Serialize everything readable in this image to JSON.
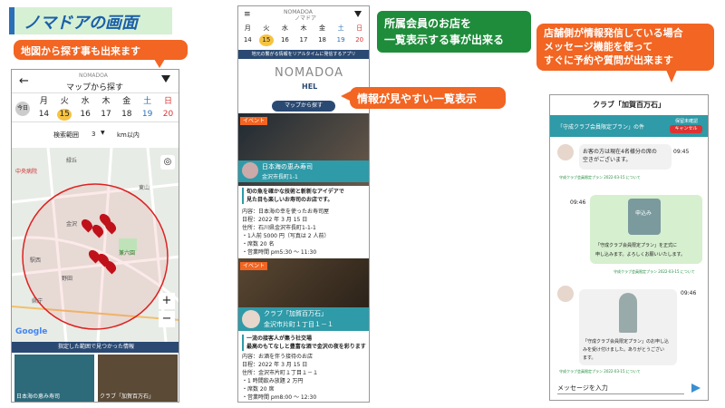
{
  "slide": {
    "title": "ノマドアの画面"
  },
  "callouts": {
    "map": "地図から探す事も出来ます",
    "list_title_1": "所属会員のお店を",
    "list_title_2": "一覧表示する事が出来る",
    "info": "情報が見やすい一覧表示",
    "msg_1": "店舗側が情報発信している場合",
    "msg_2": "メッセージ機能を使って",
    "msg_3": "すぐに予約や質問が出来ます"
  },
  "phone1": {
    "logo": "NOMADOA",
    "header": "マップから探す",
    "range_label": "検索範囲",
    "range_value": "3",
    "range_unit": "km以内",
    "weekday_label": "今日",
    "days": [
      "月",
      "火",
      "水",
      "木",
      "金",
      "土",
      "日"
    ],
    "dates": [
      "14",
      "15",
      "16",
      "17",
      "18",
      "19",
      "20"
    ],
    "result_bar": "指定した範囲で見つかった情報",
    "google": "Google",
    "plus": "+",
    "minus": "−",
    "map_labels": [
      "中央病院",
      "緑丘",
      "兼六園",
      "金沢",
      "駅西",
      "野田",
      "県庁",
      "東山"
    ],
    "thumb1": "日本海の恵み寿司",
    "thumb2": "クラブ「加賀百万石」"
  },
  "phone2": {
    "logo": "NOMADOA",
    "header_sub": "ノマドア",
    "days": [
      "月",
      "火",
      "水",
      "木",
      "金",
      "土",
      "日"
    ],
    "dates": [
      "14",
      "15",
      "16",
      "17",
      "18",
      "19",
      "20"
    ],
    "banner_text": "地元の繋がる情報をリアルタイムに発信するアプリ",
    "hero_logo": "NOMADOA",
    "hero_sub": "HEL",
    "map_button": "マップから探す",
    "event_tag": "イベント",
    "card1": {
      "name_1": "日本海の恵み寿司",
      "name_2": "金沢市長町1-1",
      "desc_1": "旬の魚を確かな技術と斬新なアイデアで",
      "desc_2": "見た目も楽しいお寿司のお店です。",
      "lines": [
        "内容：日本海の幸を使ったお寿司屋",
        "日程：2022 年 3 月 15 日",
        "住所：石川県金沢市長町1-1-1",
        "・1人前 5000 円（写真は 2 人前）",
        "・席数 20 名",
        "・営業時間 pm5:30 〜 11:30"
      ]
    },
    "card2": {
      "name_1": "クラブ「加賀百万石」",
      "name_2": "金沢市片町１丁目１－１",
      "desc_1": "一流の接客人が集う社交場",
      "desc_2": "最高のもてなしと豊富な酒で金沢の夜を彩ります",
      "lines": [
        "内容：お酒を伴う接待のお店",
        "日程：2022 年 3 月 15 日",
        "住所：金沢市片町１丁目１－１",
        "・1 時間飲み放題 2 万円",
        "・席数 20 席",
        "・営業時間 pm8:00 〜 12:30"
      ]
    }
  },
  "phone3": {
    "title": "クラブ「加賀百万石」",
    "plan": "「守成クラブ会員限定プラン」の件",
    "status": "保留未確認",
    "cancel": "キャンセル",
    "msg1_1": "お客の方は現在4名様分の席の",
    "msg1_2": "空きがございます。",
    "msg1_time": "09:45",
    "msg1_link": "守成クラブ会員限定プラン 2022-03-15 について",
    "msg2_time": "09:46",
    "msg2_1": "「守成クラブ会員限定プラン」を正式に",
    "msg2_2": "申し込みます。よろしくお願いいたします。",
    "msg2_link": "守成クラブ会員限定プラン 2022-03-15 について",
    "msg2_stamp": "申込み",
    "msg3_time": "09:46",
    "msg3_1": "「守成クラブ会員限定プラン」のお申し込",
    "msg3_2": "みを受け付けました。ありがとうござい",
    "msg3_3": "ます。",
    "msg3_link": "守成クラブ会員限定プラン 2022-03-15 について",
    "input_placeholder": "メッセージを入力"
  },
  "colors": {
    "orange": "#f26522",
    "green": "#1e8c3a",
    "teal": "#2f9aa8",
    "navy": "#2b4a73"
  }
}
